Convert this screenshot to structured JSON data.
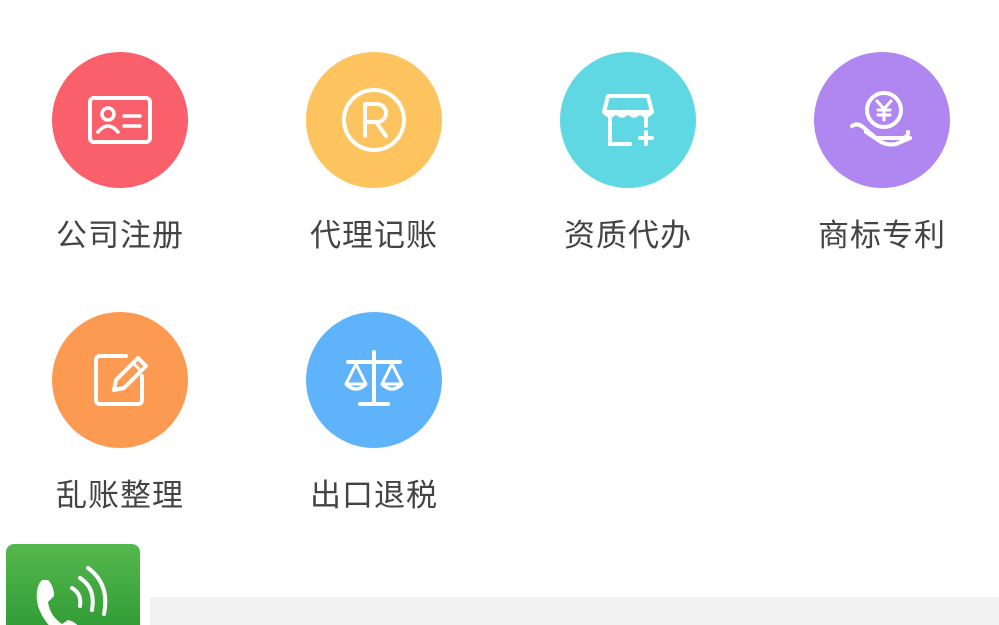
{
  "services": [
    {
      "label": "公司注册",
      "icon": "id-card-icon",
      "color": "#f9606b"
    },
    {
      "label": "代理记账",
      "icon": "registered-icon",
      "color": "#fcc35f"
    },
    {
      "label": "资质代办",
      "icon": "store-add-icon",
      "color": "#5fd8e4"
    },
    {
      "label": "商标专利",
      "icon": "yen-hand-icon",
      "color": "#b086f0"
    },
    {
      "label": "乱账整理",
      "icon": "edit-icon",
      "color": "#fd9a52"
    },
    {
      "label": "出口退税",
      "icon": "scales-icon",
      "color": "#5eb3fb"
    }
  ],
  "phone_button": {
    "icon": "phone-icon",
    "color": "#3fa83d"
  }
}
